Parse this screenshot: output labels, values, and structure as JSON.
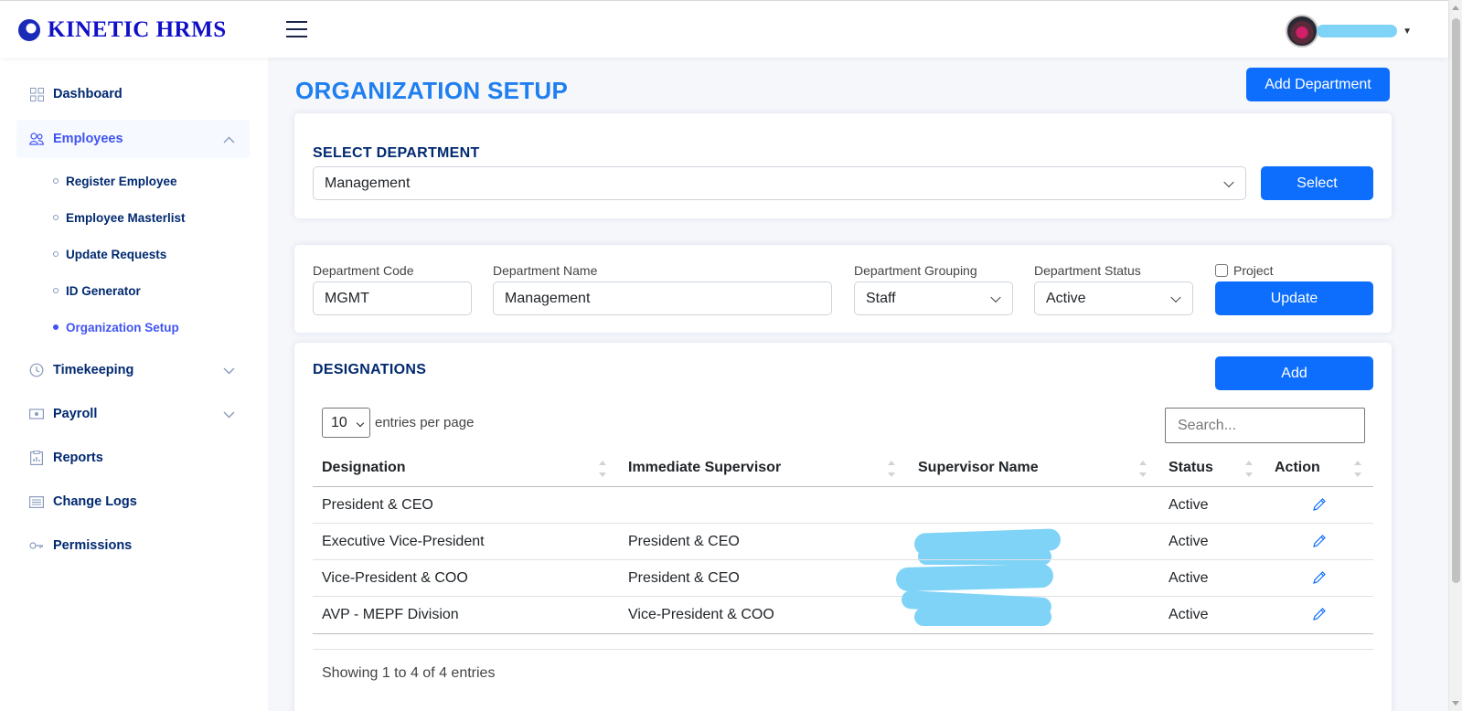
{
  "app": {
    "name": "KINETIC HRMS"
  },
  "header": {
    "user_name": ""
  },
  "sidebar": {
    "items": [
      {
        "label": "Dashboard",
        "icon": "grid-icon"
      },
      {
        "label": "Employees",
        "icon": "people-icon",
        "expanded": true
      },
      {
        "label": "Timekeeping",
        "icon": "clock-icon"
      },
      {
        "label": "Payroll",
        "icon": "cash-icon"
      },
      {
        "label": "Reports",
        "icon": "clipboard-icon"
      },
      {
        "label": "Change Logs",
        "icon": "list-icon"
      },
      {
        "label": "Permissions",
        "icon": "key-icon"
      }
    ],
    "employee_subitems": [
      {
        "label": "Register Employee"
      },
      {
        "label": "Employee Masterlist"
      },
      {
        "label": "Update Requests"
      },
      {
        "label": "ID Generator"
      },
      {
        "label": "Organization Setup",
        "active": true
      }
    ]
  },
  "page": {
    "title": "ORGANIZATION SETUP",
    "add_department_label": "Add Department"
  },
  "select_department": {
    "title": "SELECT DEPARTMENT",
    "value": "Management",
    "button_label": "Select"
  },
  "department_form": {
    "code_label": "Department Code",
    "code_value": "MGMT",
    "name_label": "Department Name",
    "name_value": "Management",
    "grouping_label": "Department Grouping",
    "grouping_value": "Staff",
    "status_label": "Department Status",
    "status_value": "Active",
    "project_label": "Project",
    "project_checked": false,
    "update_label": "Update"
  },
  "designations": {
    "title": "DESIGNATIONS",
    "add_label": "Add",
    "entries_value": "10",
    "entries_label": "entries per page",
    "search_placeholder": "Search...",
    "columns": [
      "Designation",
      "Immediate Supervisor",
      "Supervisor Name",
      "Status",
      "Action"
    ],
    "rows": [
      {
        "designation": "President & CEO",
        "supervisor": "",
        "supervisor_name": "",
        "status": "Active"
      },
      {
        "designation": "Executive Vice-President",
        "supervisor": "President & CEO",
        "supervisor_name": "",
        "status": "Active"
      },
      {
        "designation": "Vice-President & COO",
        "supervisor": "President & CEO",
        "supervisor_name": "",
        "status": "Active"
      },
      {
        "designation": "AVP - MEPF Division",
        "supervisor": "Vice-President & COO",
        "supervisor_name": "",
        "status": "Active"
      }
    ],
    "footer": "Showing 1 to 4 of 4 entries"
  },
  "colors": {
    "primary": "#0d6efd",
    "title_blue": "#1f7ff0",
    "nav_dark": "#012970",
    "nav_active": "#4154f1",
    "redaction": "#7fd3f7"
  }
}
